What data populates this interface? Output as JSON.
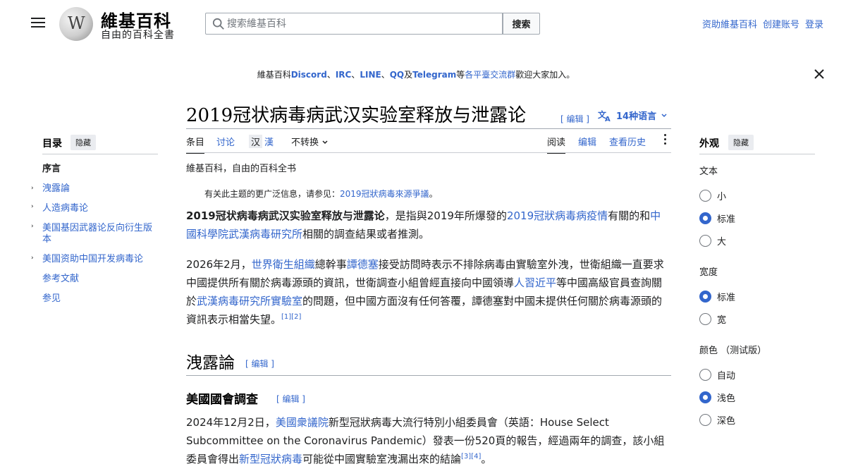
{
  "header": {
    "logo_wordmark": "維基百科",
    "logo_tagline": "自由的百科全書",
    "search_placeholder": "搜索維基百科",
    "search_button": "搜索",
    "links": [
      "资助維基百科",
      "创建账号",
      "登录"
    ]
  },
  "banner": {
    "prefix": "維基百科",
    "discord": "Discord",
    "sep1": "、",
    "irc": "IRC",
    "sep2": "、",
    "line": "LINE",
    "sep3": "、",
    "qq": "QQ",
    "and": "及",
    "telegram": "Telegram",
    "mid": "等",
    "groups": "各平臺交流群",
    "suffix": "歡迎大家加入。"
  },
  "article": {
    "title": "2019冠状病毒病武汉实验室释放与泄露论",
    "edit_label": "[ 编辑 ]",
    "languages": "14种语言",
    "tabs": {
      "article": "条目",
      "talk": "讨论",
      "variant_hant": "汉",
      "variant_hans": "漢",
      "noconvert": "不转换",
      "read": "阅读",
      "edit": "编辑",
      "history": "查看历史"
    },
    "tagline": "維基百科，自由的百科全书",
    "hatnote_prefix": "有关此主题的更广泛信息，请参见：",
    "hatnote_link": "2019冠狀病毒來源爭議",
    "hatnote_suffix": "。",
    "p1": {
      "bold": "2019冠状病毒病武汉实验室释放与泄露论",
      "t1": "，是指與2019年所爆發的",
      "l1": "2019冠狀病毒病疫情",
      "t2": "有關的和",
      "l2": "中國科學院武漢病毒研究所",
      "t3": "相關的調查結果或者推測。"
    },
    "p2": {
      "t1": "2026年2月，",
      "l1": "世界衛生組織",
      "t2": "總幹事",
      "l2": "譚德塞",
      "t3": "接受訪問時表示不排除病毒由實驗室外洩，世衛組織一直要求中國提供所有關於病毒源頭的資訊，世衛調查小組曾經直接向中國領導",
      "l3": "人",
      "l4": "習近平",
      "t4": "等中國高級官員查詢關於",
      "l5": "武漢病毒研究所實驗室",
      "t5": "的問題，但中國方面沒有任何答覆，譚德塞對中國未提供任何關於病毒源頭的資訊表示相當失望。",
      "ref": "[1][2]"
    },
    "h2": "洩露論",
    "h3": "美國國會調查",
    "p3": {
      "t1": "2024年12月2日，",
      "l1": "美國衆議院",
      "t2": "新型冠狀病毒大流行特別小組委員會（英語：House Select Subcommittee on the Coronavirus Pandemic）發表一份520頁的報告，經過兩年的調查，該小組委員會得出",
      "l2": "新型冠狀病毒",
      "t3": "可能從中國實驗室洩漏出來的結論",
      "ref": "[3][4]",
      "t4": "。"
    }
  },
  "toc": {
    "title": "目录",
    "hide": "隐藏",
    "items": [
      "序言",
      "洩露論",
      "人造病毒论",
      "美国基因武器论反向衍生版本",
      "美国资助中国开发病毒论",
      "参考文献",
      "参见"
    ]
  },
  "appearance": {
    "title": "外观",
    "hide": "隐藏",
    "text_label": "文本",
    "text_options": [
      "小",
      "标准",
      "大"
    ],
    "text_selected": "标准",
    "width_label": "宽度",
    "width_options": [
      "标准",
      "宽"
    ],
    "width_selected": "标准",
    "color_label": "颜色 （测试版）",
    "color_options": [
      "自动",
      "浅色",
      "深色"
    ],
    "color_selected": "浅色"
  },
  "colors": {
    "link": "#3366cc",
    "text": "#202122",
    "divider": "#a2a9b1"
  }
}
